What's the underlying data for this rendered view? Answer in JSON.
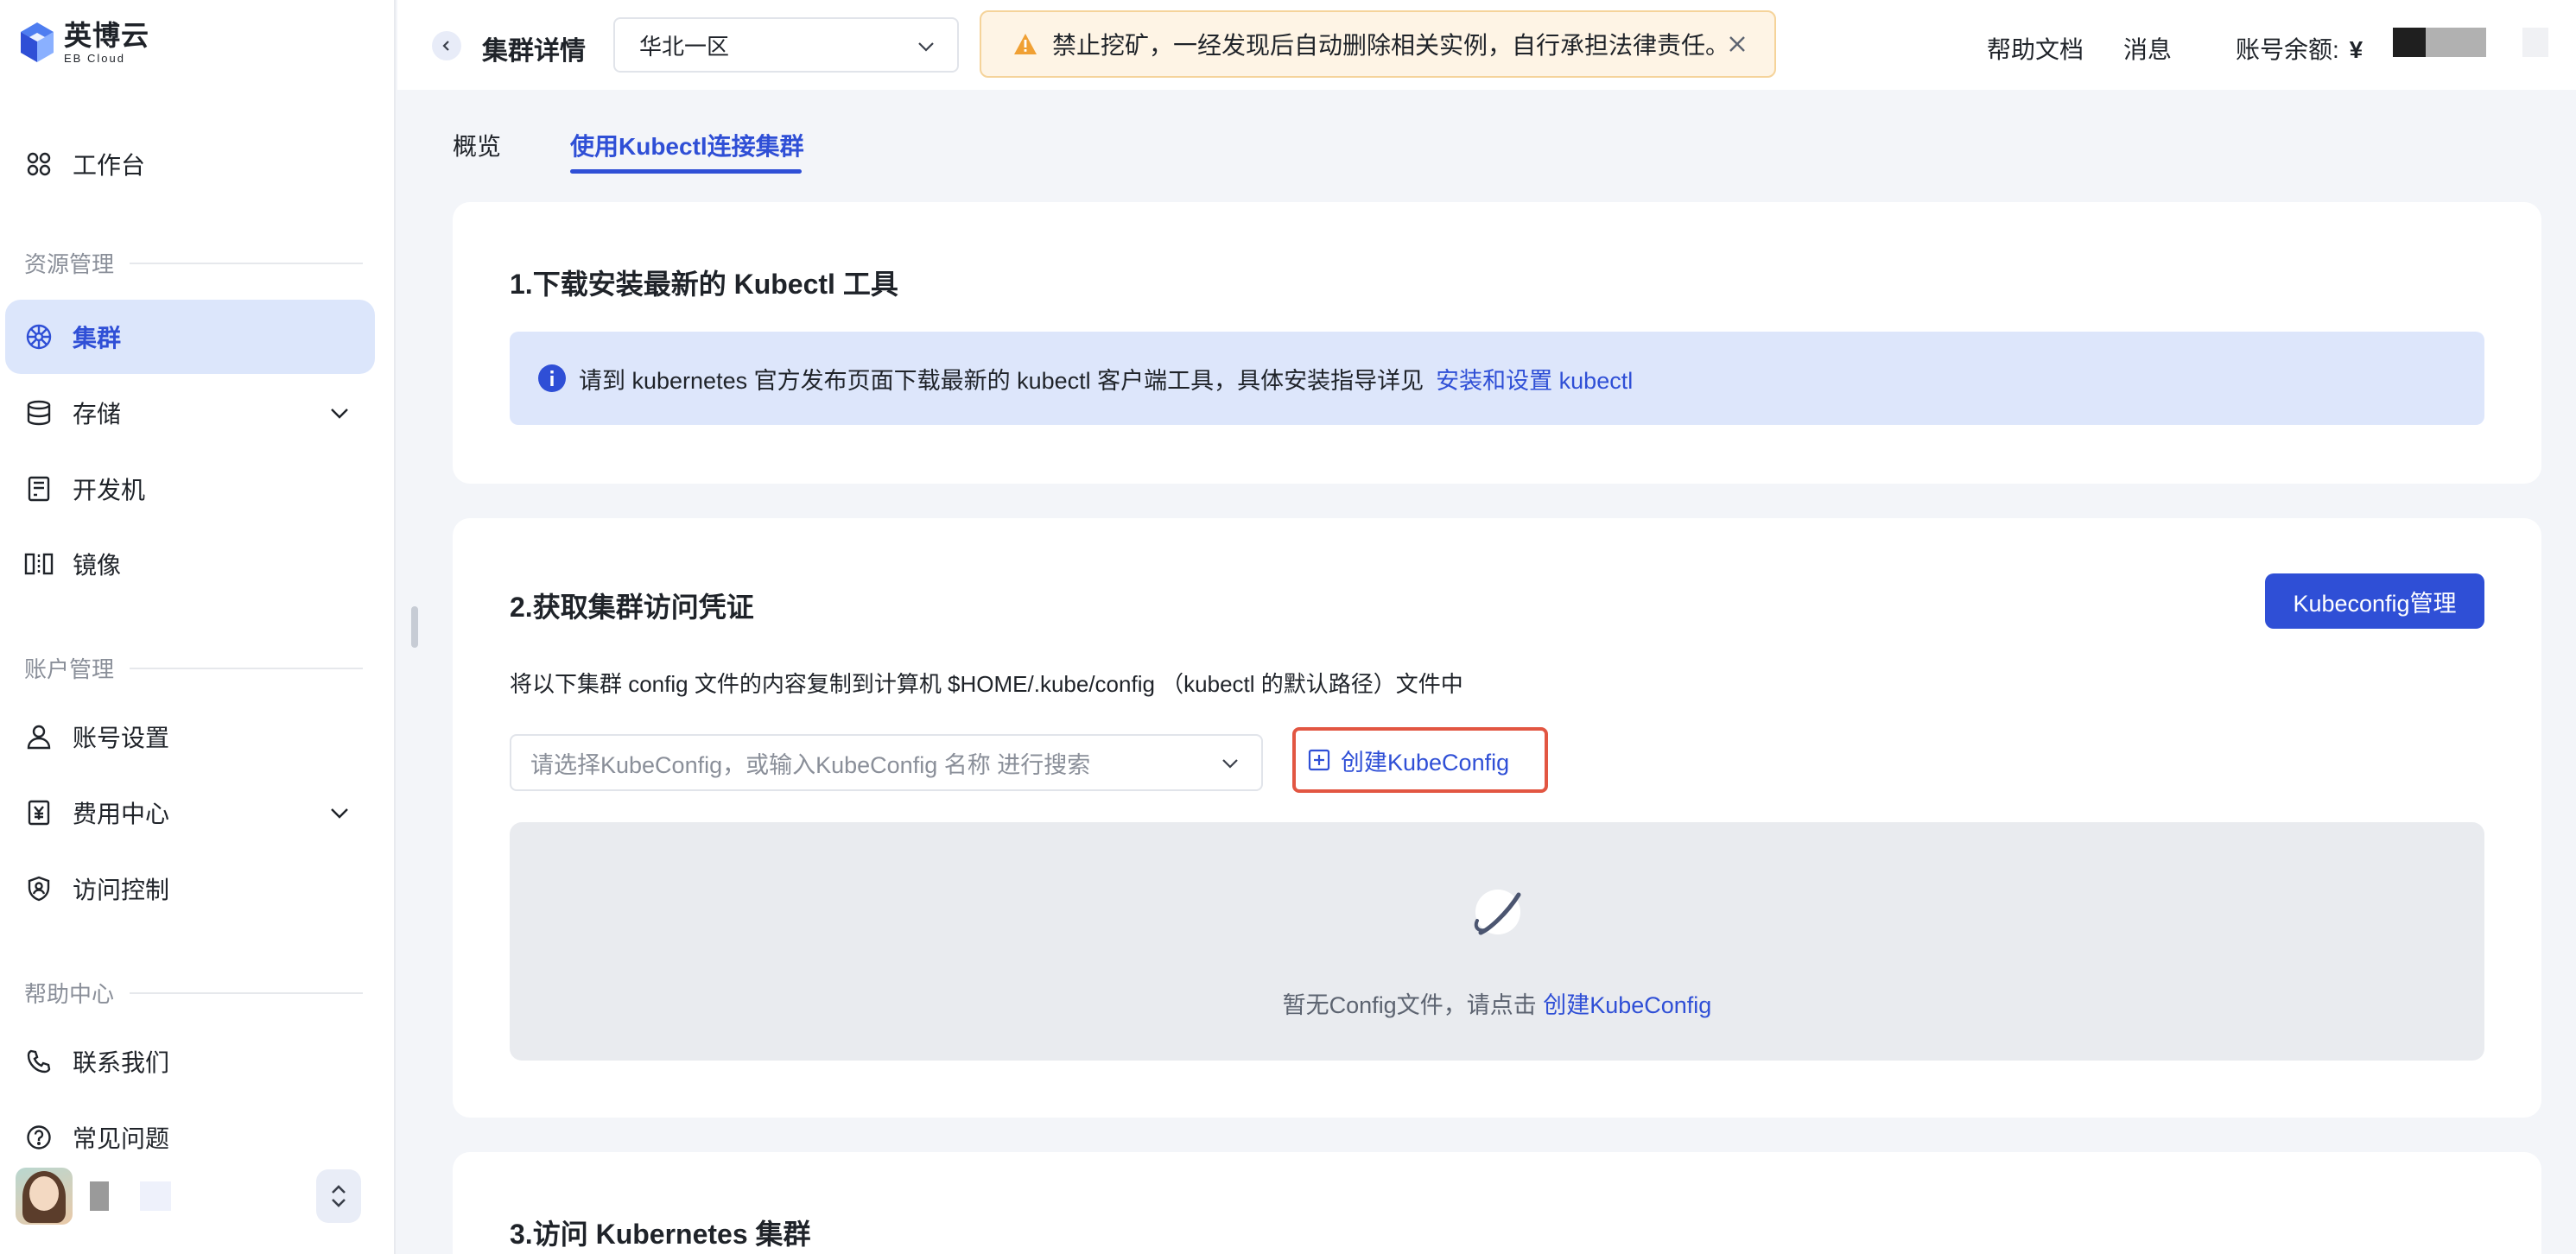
{
  "brand": {
    "name_cn": "英博云",
    "name_en": "EB Cloud"
  },
  "sidebar": {
    "workbench": "工作台",
    "sections": {
      "resource": "资源管理",
      "account": "账户管理",
      "help": "帮助中心"
    },
    "items": [
      {
        "label": "集群",
        "icon": "cluster-icon",
        "active": true
      },
      {
        "label": "存储",
        "icon": "database-icon",
        "expandable": true
      },
      {
        "label": "开发机",
        "icon": "devbox-icon"
      },
      {
        "label": "镜像",
        "icon": "image-icon"
      },
      {
        "label": "账号设置",
        "icon": "user-icon"
      },
      {
        "label": "费用中心",
        "icon": "yen-icon",
        "expandable": true
      },
      {
        "label": "访问控制",
        "icon": "shield-icon"
      },
      {
        "label": "联系我们",
        "icon": "phone-icon"
      },
      {
        "label": "常见问题",
        "icon": "question-icon"
      }
    ]
  },
  "header": {
    "title": "集群详情",
    "region": "华北一区",
    "warning": "禁止挖矿，一经发现后自动删除相关实例，自行承担法律责任。",
    "help_docs": "帮助文档",
    "messages": "消息",
    "balance_label": "账号余额:",
    "currency": "¥"
  },
  "tabs": [
    {
      "label": "概览",
      "active": false
    },
    {
      "label": "使用Kubectl连接集群",
      "active": true
    }
  ],
  "step1": {
    "title": "1.下载安装最新的 Kubectl 工具",
    "info_text": "请到 kubernetes 官方发布页面下载最新的 kubectl 客户端工具，具体安装指导详见",
    "info_link": "安装和设置 kubectl"
  },
  "step2": {
    "title": "2.获取集群访问凭证",
    "manage_button": "Kubeconfig管理",
    "description": "将以下集群 config 文件的内容复制到计算机 $HOME/.kube/config （kubectl 的默认路径）文件中",
    "select_placeholder": "请选择KubeConfig，或输入KubeConfig 名称 进行搜索",
    "create_button": "创建KubeConfig",
    "empty_text": "暂无Config文件，请点击",
    "empty_link": "创建KubeConfig"
  },
  "step3": {
    "title": "3.访问 Kubernetes 集群"
  },
  "colors": {
    "accent": "#2f4fd6",
    "active_bg": "#dce6fb",
    "warning_bg": "#fef4e5",
    "highlight_border": "#e25642"
  }
}
